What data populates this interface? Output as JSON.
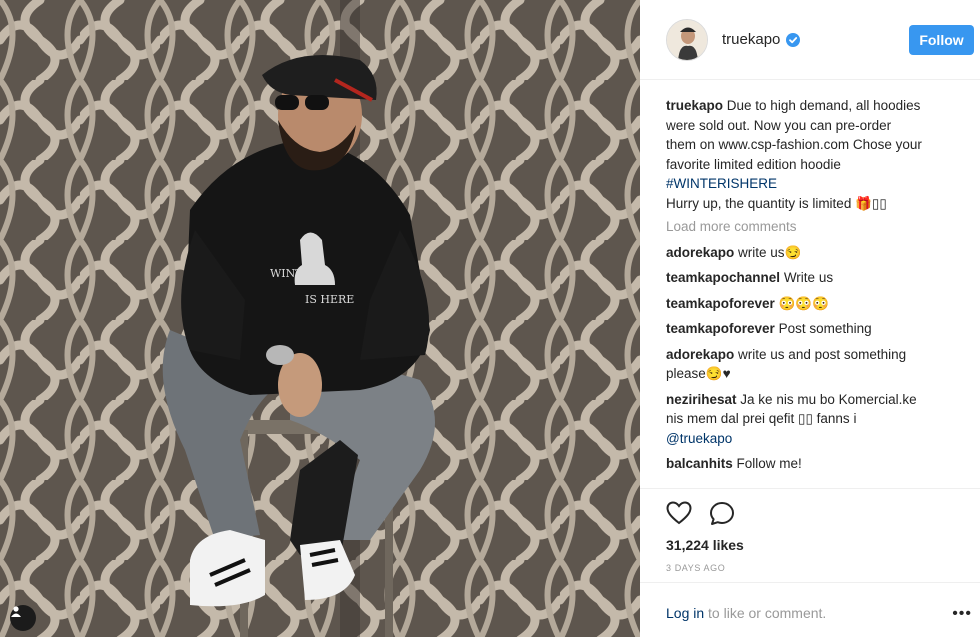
{
  "post": {
    "username": "truekapo",
    "follow_label": "Follow",
    "caption": {
      "username": "truekapo",
      "lines": [
        "Due to high demand, all hoodies",
        "were sold out. Now you can pre-order",
        "them on www.csp-fashion.com Chose your",
        "favorite limited edition hoodie"
      ],
      "hashtag": "#WINTERISHERE",
      "last_line": "Hurry up, the quantity is limited 🎁▯▯"
    },
    "load_more": "Load more comments",
    "comments": [
      {
        "user": "adorekapo",
        "text": "write us😏"
      },
      {
        "user": "teamkapochannel",
        "text": "Write us"
      },
      {
        "user": "teamkapoforever",
        "text": "😳😳😳"
      },
      {
        "user": "teamkapoforever",
        "text": "Post something"
      },
      {
        "user": "adorekapo",
        "text": "write us and post something",
        "text2": "please😏♥"
      },
      {
        "user": "nezirihesat",
        "text": "Ja ke nis mu bo Komercial.ke",
        "text2": "nis mem dal prei qefit ▯▯ fanns i",
        "mention": "@truekapo"
      },
      {
        "user": "balcanhits",
        "text": "Follow me!"
      }
    ],
    "likes": "31,224 likes",
    "time_ago": "3 DAYS AGO",
    "login_link": "Log in",
    "login_suffix": " to like or comment.",
    "more_label": "•••"
  },
  "photo": {
    "hoodie_print_line1": "WINT",
    "hoodie_print_line2": "IS HERE"
  },
  "colors": {
    "follow_button": "#3897f0",
    "verified_badge": "#3897f0",
    "link": "#003569"
  },
  "icons": [
    "user-tag-icon",
    "verified-icon",
    "heart-icon",
    "comment-icon",
    "more-icon"
  ]
}
